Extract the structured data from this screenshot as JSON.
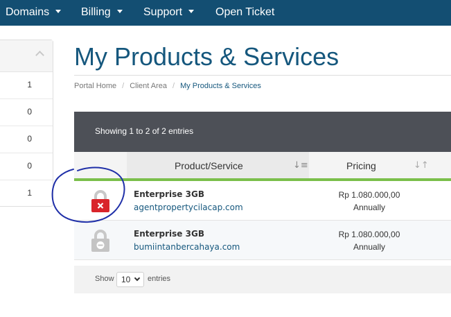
{
  "nav": {
    "items": [
      {
        "label": "Domains",
        "has_dropdown": true
      },
      {
        "label": "Billing",
        "has_dropdown": true
      },
      {
        "label": "Support",
        "has_dropdown": true
      },
      {
        "label": "Open Ticket",
        "has_dropdown": false
      }
    ]
  },
  "sidebar": {
    "counts": [
      "1",
      "0",
      "0",
      "0",
      "1"
    ]
  },
  "page": {
    "title": "My Products & Services",
    "breadcrumb": [
      "Portal Home",
      "Client Area",
      "My Products & Services"
    ]
  },
  "table": {
    "info": "Showing 1 to 2 of 2 entries",
    "columns": [
      "Product/Service",
      "Pricing"
    ],
    "rows": [
      {
        "product": "Enterprise 3GB",
        "domain": "agentpropertycilacap.com",
        "price": "Rp 1.080.000,00",
        "cycle": "Annually",
        "status_icon": "lock-suspended-icon",
        "status_color": "#d9242a"
      },
      {
        "product": "Enterprise 3GB",
        "domain": "bumiintanbercahaya.com",
        "price": "Rp 1.080.000,00",
        "cycle": "Annually",
        "status_icon": "lock-cancelled-icon",
        "status_color": "#c4c4c4"
      }
    ],
    "footer": {
      "show_label": "Show",
      "page_length": "10",
      "entries_label": "entries"
    }
  },
  "colors": {
    "nav_bg": "#134e72",
    "accent": "#15577d",
    "table_header_bg": "#4d5057",
    "green_rule": "#7bbf4b",
    "annotation": "#1f2fa8"
  }
}
